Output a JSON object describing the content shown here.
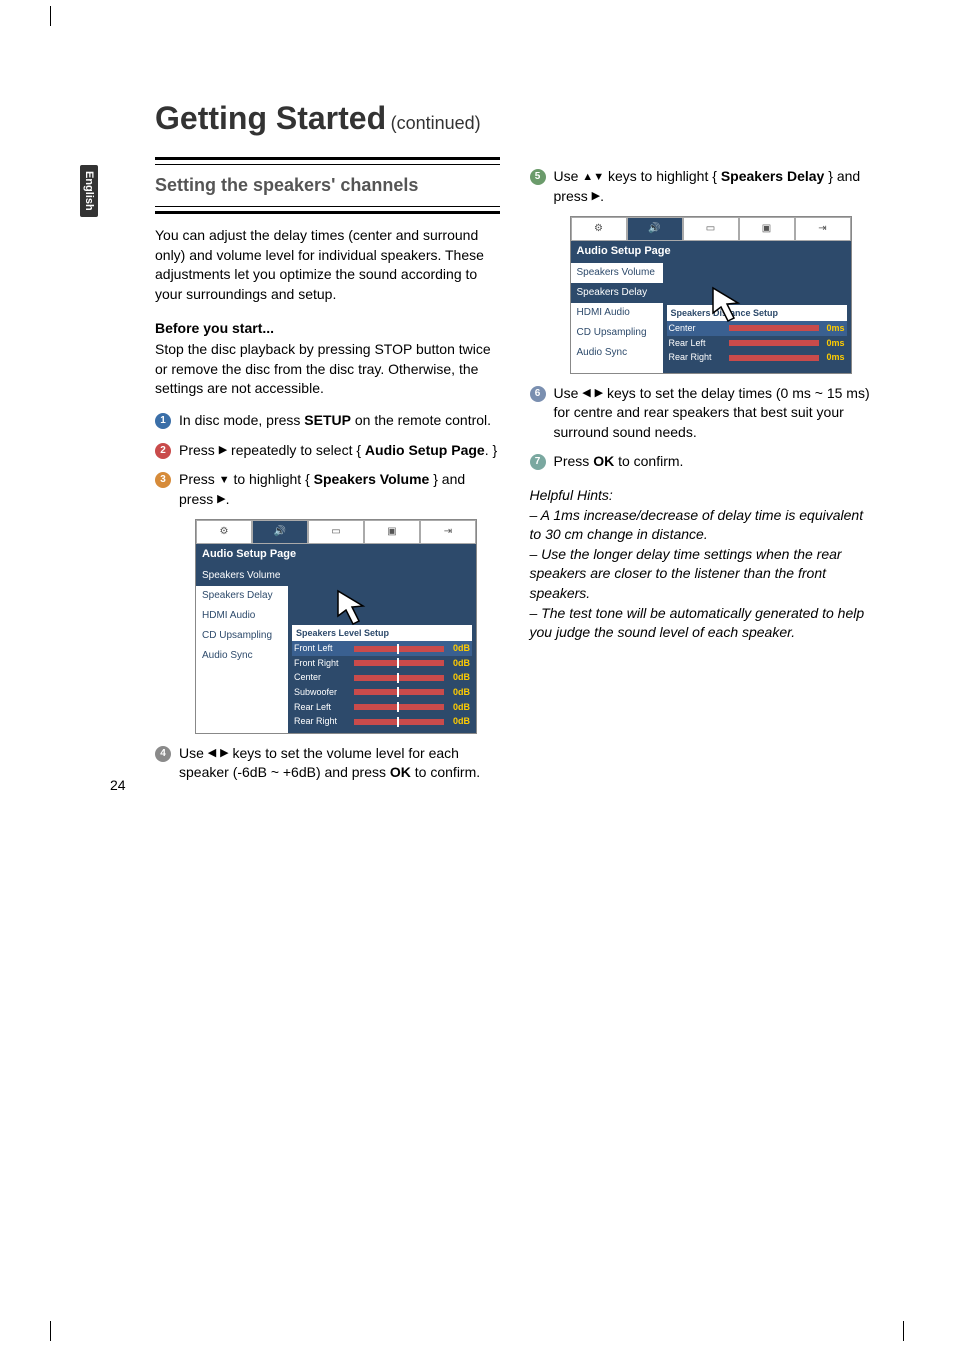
{
  "lang_tab": "English",
  "title": "Getting Started",
  "continued": "(continued)",
  "section_heading": "Setting the speakers' channels",
  "intro": "You can adjust the delay times (center and surround only) and volume level for individual speakers. These adjustments let you optimize the sound according to your surroundings and setup.",
  "before_start_h": "Before you start...",
  "before_start": "Stop the disc playback by pressing STOP button twice or remove the disc from the disc tray.  Otherwise, the settings are not accessible.",
  "step1_a": "In disc mode, press ",
  "step1_b": "SETUP",
  "step1_c": " on the remote control.",
  "step2_a": "Press ",
  "step2_b": " repeatedly to select { ",
  "step2_c": "Audio Setup Page",
  "step2_d": ". }",
  "step3_a": "Press ",
  "step3_b": " to highlight { ",
  "step3_c": "Speakers Volume",
  "step3_d": " } and press ",
  "step4_a": "Use ",
  "step4_b": " keys to set the volume level for each speaker (-6dB ~ +6dB) and press ",
  "step4_c": "OK",
  "step4_d": " to confirm.",
  "step5_a": "Use ",
  "step5_b": " keys to highlight { ",
  "step5_c": "Speakers Delay",
  "step5_d": " } and press ",
  "step6_a": "Use ",
  "step6_b": " keys to set the delay times (0 ms ~ 15 ms) for centre and rear speakers that best suit your surround sound needs.",
  "step7_a": "Press ",
  "step7_b": "OK",
  "step7_c": " to confirm.",
  "hints_h": "Helpful Hints:",
  "hint1": "– A 1ms increase/decrease of delay time is equivalent to 30 cm change in distance.",
  "hint2": "– Use the longer delay time settings when the rear speakers are closer to the listener than the front speakers.",
  "hint3": "– The test tone will be automatically generated to help you judge the sound level of each speaker.",
  "osd1": {
    "header": "Audio Setup Page",
    "items": [
      "Speakers Volume",
      "Speakers Delay",
      "HDMI Audio",
      "CD Upsampling",
      "Audio Sync"
    ],
    "sel": 0,
    "panel": "Speakers Level Setup",
    "rows": [
      {
        "lab": "Front Left",
        "val": "0dB",
        "hl": true
      },
      {
        "lab": "Front Right",
        "val": "0dB"
      },
      {
        "lab": "Center",
        "val": "0dB"
      },
      {
        "lab": "Subwoofer",
        "val": "0dB"
      },
      {
        "lab": "Rear Left",
        "val": "0dB"
      },
      {
        "lab": "Rear Right",
        "val": "0dB"
      }
    ]
  },
  "osd2": {
    "header": "Audio Setup Page",
    "items": [
      "Speakers Volume",
      "Speakers Delay",
      "HDMI Audio",
      "CD Upsampling",
      "Audio Sync"
    ],
    "sel": 1,
    "panel": "Speakers Distance Setup",
    "rows": [
      {
        "lab": "Center",
        "val": "0ms",
        "hl": true
      },
      {
        "lab": "Rear Left",
        "val": "0ms"
      },
      {
        "lab": "Rear Right",
        "val": "0ms"
      }
    ]
  },
  "pagenum": "24"
}
